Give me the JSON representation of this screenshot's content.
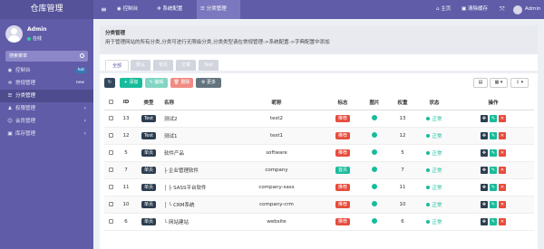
{
  "sidebar": {
    "title": "仓库管理",
    "user": {
      "name": "Admin",
      "status": "在线"
    },
    "search_placeholder": "搜索菜单",
    "items": [
      {
        "label": "控制台",
        "icon": "dashboard-icon",
        "badge": "hot"
      },
      {
        "label": "常规管理",
        "icon": "cogs-icon",
        "badge": "new"
      },
      {
        "label": "分类管理",
        "icon": "list-icon",
        "active": true
      },
      {
        "label": "权限管理",
        "icon": "group-icon",
        "arrow": "‹"
      },
      {
        "label": "会员管理",
        "icon": "user-icon",
        "arrow": "‹"
      },
      {
        "label": "库存管理",
        "icon": "box-icon",
        "arrow": "‹"
      }
    ]
  },
  "topbar": {
    "menu_icon": "≡",
    "tabs": [
      {
        "label": "控制台",
        "icon": "dashboard-icon"
      },
      {
        "label": "系统配置",
        "icon": "gear-icon"
      },
      {
        "label": "分类管理",
        "icon": "list-icon",
        "active": true
      }
    ],
    "right": {
      "home": "主页",
      "clear_cache": "清除缓存",
      "admin": "Admin"
    }
  },
  "info": {
    "title": "分类管理",
    "description": "用于管理网站的所有分类,分类可进行无限级分类,分类类型请在常规管理->系统配置->字典配置中添加",
    "tabs": [
      "全部",
      "默认",
      "单页",
      "文章",
      "Test"
    ]
  },
  "toolbar": {
    "refresh": "↻",
    "add": "+ 添加",
    "edit": "✎ 编辑",
    "delete": "🗑 删除",
    "more": "⚙ 更多"
  },
  "table": {
    "headers": [
      "",
      "ID",
      "类型",
      "名称",
      "昵称",
      "标志",
      "图片",
      "权重",
      "状态",
      "操作"
    ],
    "rows": [
      {
        "id": "13",
        "type": "Test",
        "name": "测试2",
        "nickname": "test2",
        "flag": "推荐",
        "flag_kind": "recommend",
        "weigh": "13",
        "status": "正常"
      },
      {
        "id": "12",
        "type": "Test",
        "name": "测试1",
        "nickname": "test1",
        "flag": "推荐",
        "flag_kind": "recommend",
        "weigh": "12",
        "status": "正常"
      },
      {
        "id": "5",
        "type": "单页",
        "name": "软件产品",
        "nickname": "software",
        "flag": "推荐",
        "flag_kind": "recommend",
        "weigh": "5",
        "status": "正常"
      },
      {
        "id": "7",
        "type": "单页",
        "name": "├ 企业管理软件",
        "nickname": "company",
        "flag": "首页",
        "flag_kind": "index",
        "weigh": "7",
        "status": "正常"
      },
      {
        "id": "11",
        "type": "单页",
        "name": "│ ├ SASS平台软件",
        "nickname": "company-sass",
        "flag": "推荐",
        "flag_kind": "recommend",
        "weigh": "11",
        "status": "正常"
      },
      {
        "id": "10",
        "type": "单页",
        "name": "│ └ CRM系统",
        "nickname": "company-crm",
        "flag": "推荐",
        "flag_kind": "recommend",
        "weigh": "10",
        "status": "正常"
      },
      {
        "id": "6",
        "type": "单页",
        "name": "└ 网站建站",
        "nickname": "website",
        "flag": "推荐",
        "flag_kind": "recommend",
        "weigh": "6",
        "status": "正常"
      }
    ]
  }
}
